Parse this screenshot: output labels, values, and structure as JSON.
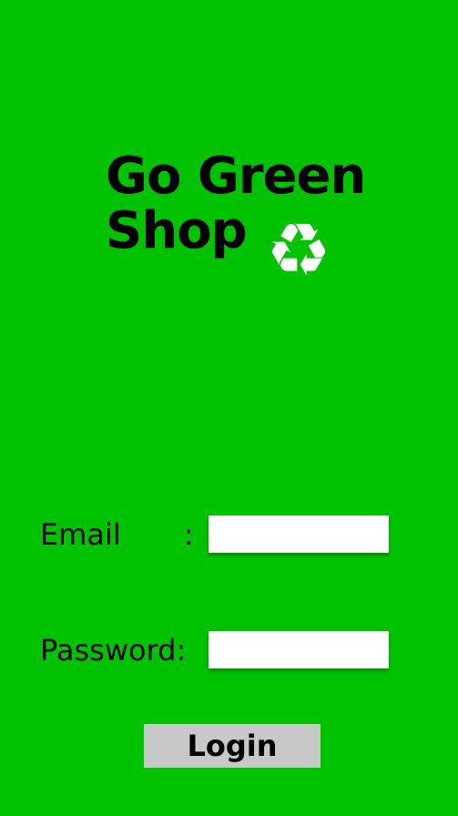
{
  "app": {
    "title_line1": "Go Green",
    "title_line2": "Shop",
    "title_icon": "recycle-icon",
    "title_icon_glyph": "♻"
  },
  "form": {
    "email_label": "Email",
    "email_colon": ":",
    "email_value": "",
    "password_label": "Password:",
    "password_value": "",
    "login_label": "Login"
  },
  "colors": {
    "background": "#00c200",
    "icon": "#ffffff",
    "field_background": "#ffffff",
    "button_background": "#c8c8c8",
    "text": "#000000"
  }
}
